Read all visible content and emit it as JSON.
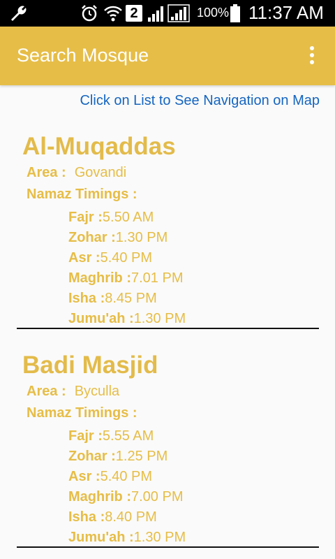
{
  "status_bar": {
    "sim_slot": "2",
    "battery": "100%",
    "time": "11:37 AM"
  },
  "app_bar": {
    "title": "Search Mosque"
  },
  "hint": "Click on List to See Navigation on Map",
  "labels": {
    "area": "Area :",
    "namaz_timings": "Namaz Timings :"
  },
  "mosques": [
    {
      "name": "Al-Muqaddas",
      "area": "Govandi",
      "timings": [
        {
          "label": "Fajr :",
          "time": "5.50 AM"
        },
        {
          "label": "Zohar :",
          "time": "1.30 PM"
        },
        {
          "label": "Asr :",
          "time": "5.40 PM"
        },
        {
          "label": "Maghrib :",
          "time": "7.01 PM"
        },
        {
          "label": "Isha :",
          "time": "8.45 PM"
        },
        {
          "label": "Jumu'ah :",
          "time": "1.30 PM"
        }
      ]
    },
    {
      "name": "Badi Masjid",
      "area": "Byculla",
      "timings": [
        {
          "label": "Fajr :",
          "time": "5.55 AM"
        },
        {
          "label": "Zohar :",
          "time": "1.25 PM"
        },
        {
          "label": "Asr :",
          "time": "5.40 PM"
        },
        {
          "label": "Maghrib :",
          "time": "7.00 PM"
        },
        {
          "label": "Isha :",
          "time": "8.40 PM"
        },
        {
          "label": "Jumu'ah :",
          "time": "1.30 PM"
        }
      ]
    }
  ],
  "colors": {
    "accent": "#e6bd47",
    "link": "#1565c0",
    "background": "#fafafa"
  }
}
